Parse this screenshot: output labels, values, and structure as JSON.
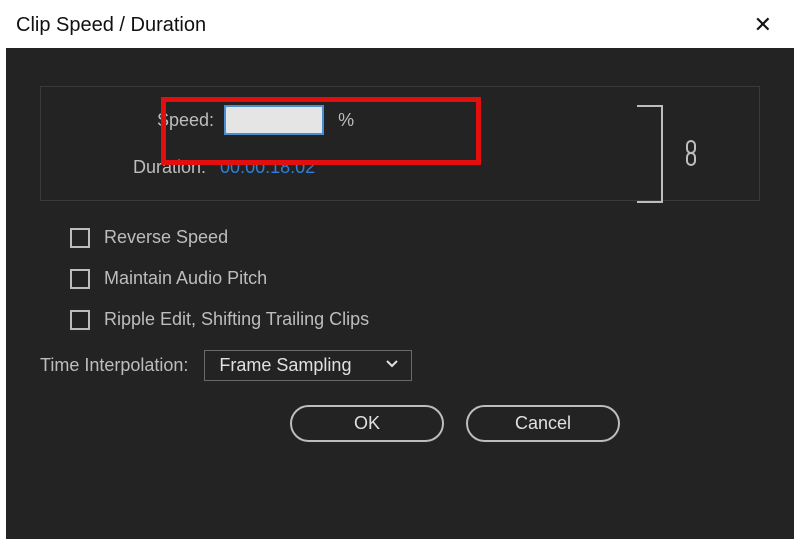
{
  "window": {
    "title": "Clip Speed / Duration"
  },
  "fields": {
    "speed_label": "Speed:",
    "speed_value": "",
    "speed_percent": "%",
    "duration_label": "Duration:",
    "duration_value": "00:00:18:02"
  },
  "checkboxes": {
    "reverse": "Reverse Speed",
    "maintain_pitch": "Maintain Audio Pitch",
    "ripple": "Ripple Edit, Shifting Trailing Clips"
  },
  "time_interpolation": {
    "label": "Time Interpolation:",
    "selected": "Frame Sampling"
  },
  "buttons": {
    "ok": "OK",
    "cancel": "Cancel"
  },
  "icons": {
    "close": "✕",
    "chevron_down": "⌄"
  }
}
